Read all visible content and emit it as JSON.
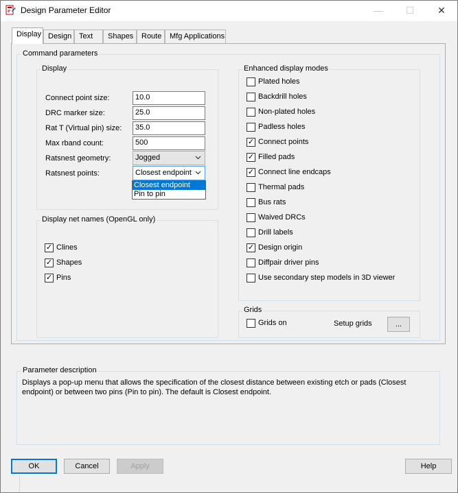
{
  "window": {
    "title": "Design Parameter Editor",
    "minimize": "—",
    "maximize": "☐",
    "close": "✕"
  },
  "tabs": [
    "Display",
    "Design",
    "Text",
    "Shapes",
    "Route",
    "Mfg Applications"
  ],
  "command_parameters": {
    "label": "Command parameters",
    "display_group": {
      "label": "Display",
      "fields": {
        "connect_point_size": {
          "label": "Connect point size:",
          "value": "10.0"
        },
        "drc_marker_size": {
          "label": "DRC marker size:",
          "value": "25.0"
        },
        "rat_t_size": {
          "label": "Rat T (Virtual pin) size:",
          "value": "35.0"
        },
        "max_rband_count": {
          "label": "Max rband count:",
          "value": "500"
        },
        "ratsnest_geometry": {
          "label": "Ratsnest geometry:",
          "value": "Jogged"
        },
        "ratsnest_points": {
          "label": "Ratsnest points:",
          "value": "Closest endpoint"
        }
      },
      "ratsnest_points_options": [
        "Closest endpoint",
        "Pin to pin"
      ]
    },
    "net_names_group": {
      "label": "Display net names (OpenGL only)",
      "items": [
        {
          "label": "Clines",
          "checked": "✓"
        },
        {
          "label": "Shapes",
          "checked": "✓"
        },
        {
          "label": "Pins",
          "checked": "✓"
        }
      ]
    },
    "enhanced_group": {
      "label": "Enhanced display modes",
      "items": [
        {
          "label": "Plated holes",
          "checked": ""
        },
        {
          "label": "Backdrill holes",
          "checked": ""
        },
        {
          "label": "Non-plated holes",
          "checked": ""
        },
        {
          "label": "Padless holes",
          "checked": ""
        },
        {
          "label": "Connect points",
          "checked": "✓"
        },
        {
          "label": "Filled pads",
          "checked": "✓"
        },
        {
          "label": "Connect line endcaps",
          "checked": "✓"
        },
        {
          "label": "Thermal pads",
          "checked": ""
        },
        {
          "label": "Bus rats",
          "checked": ""
        },
        {
          "label": "Waived DRCs",
          "checked": ""
        },
        {
          "label": "Drill labels",
          "checked": ""
        },
        {
          "label": "Design origin",
          "checked": "✓"
        },
        {
          "label": "Diffpair driver pins",
          "checked": ""
        },
        {
          "label": "Use secondary step models in 3D viewer",
          "checked": ""
        }
      ]
    },
    "grids_group": {
      "label": "Grids",
      "grids_on": {
        "label": "Grids on",
        "checked": ""
      },
      "setup_grids_label": "Setup grids",
      "setup_grids_button": "..."
    }
  },
  "parameter_description": {
    "label": "Parameter description",
    "line1": "Displays a pop-up menu that allows the specification of the closest distance between existing etch or pads (Closest",
    "line2": "endpoint) or between two pins (Pin to pin). The default is Closest endpoint."
  },
  "buttons": {
    "ok": "OK",
    "cancel": "Cancel",
    "apply": "Apply",
    "help": "Help"
  },
  "colors": {
    "accent": "#0078d7",
    "background": "#f0f0f0"
  }
}
